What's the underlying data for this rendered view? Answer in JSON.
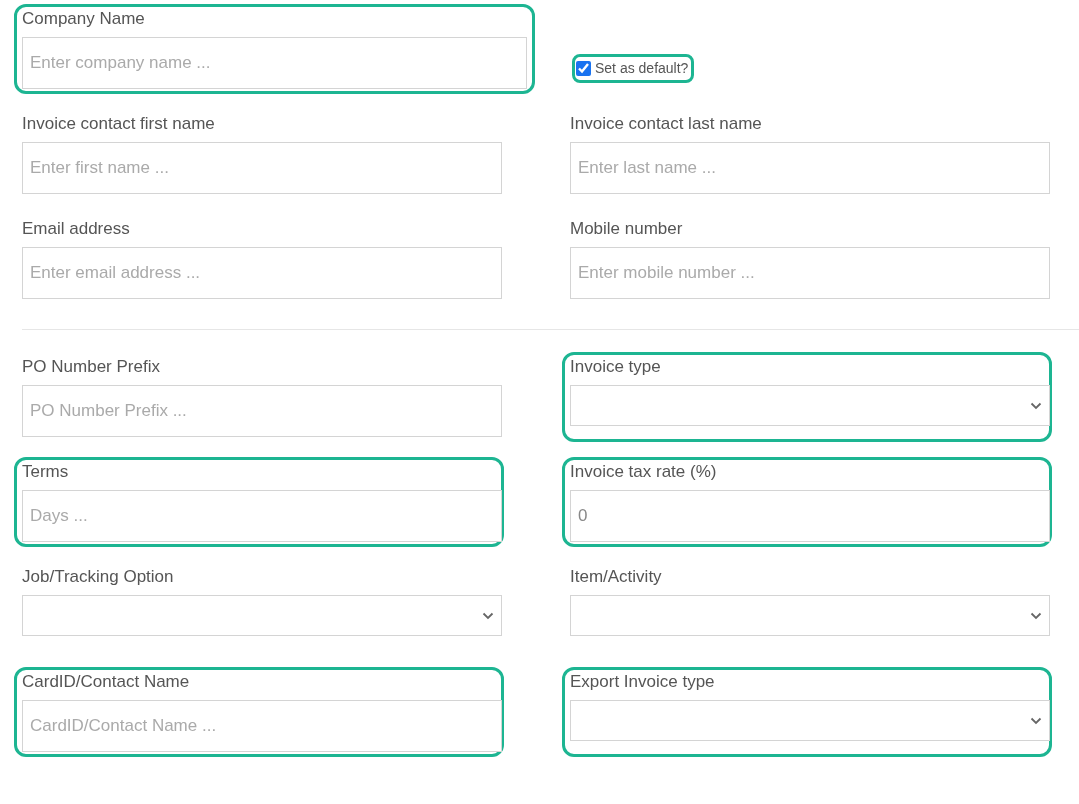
{
  "company": {
    "kind": "text",
    "label": "Company Name",
    "placeholder": "Enter company name ...",
    "highlighted": true
  },
  "default_checkbox": {
    "label": "Set as default?",
    "checked": true,
    "highlighted": true
  },
  "contact_rows": [
    [
      {
        "kind": "text",
        "label": "Invoice contact first name",
        "placeholder": "Enter first name ...",
        "highlighted": false
      },
      {
        "kind": "text",
        "label": "Invoice contact last name",
        "placeholder": "Enter last name ...",
        "highlighted": false
      }
    ],
    [
      {
        "kind": "text",
        "label": "Email address",
        "placeholder": "Enter email address ...",
        "highlighted": false
      },
      {
        "kind": "text",
        "label": "Mobile number",
        "placeholder": "Enter mobile number ...",
        "highlighted": false
      }
    ]
  ],
  "invoice_rows": [
    [
      {
        "kind": "text",
        "label": "PO Number Prefix",
        "placeholder": "PO Number Prefix ...",
        "highlighted": false
      },
      {
        "kind": "select",
        "label": "Invoice type",
        "highlighted": true
      }
    ],
    [
      {
        "kind": "text",
        "label": "Terms",
        "placeholder": "Days ...",
        "highlighted": true
      },
      {
        "kind": "text",
        "label": "Invoice tax rate (%)",
        "value": "0",
        "highlighted": true
      }
    ],
    [
      {
        "kind": "select",
        "label": "Job/Tracking Option",
        "highlighted": false
      },
      {
        "kind": "select",
        "label": "Item/Activity",
        "highlighted": false
      }
    ],
    [
      {
        "kind": "text",
        "label": "CardID/Contact Name",
        "placeholder": "CardID/Contact Name ...",
        "highlighted": true
      },
      {
        "kind": "select",
        "label": "Export Invoice type",
        "highlighted": true
      }
    ]
  ]
}
